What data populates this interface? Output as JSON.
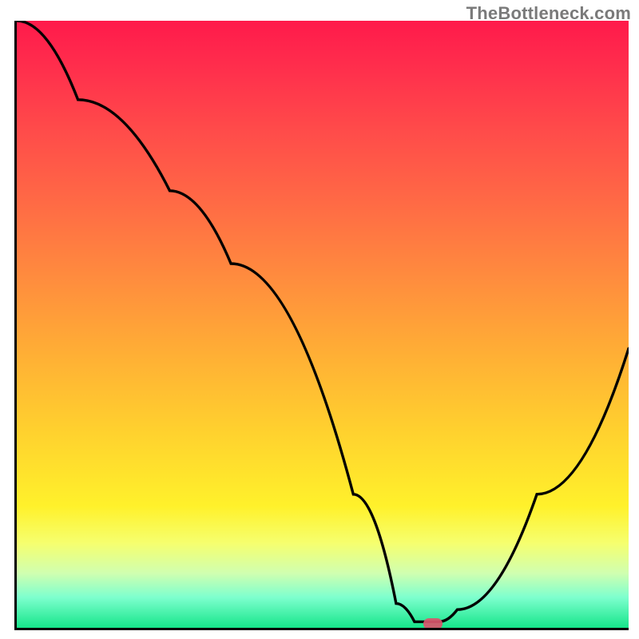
{
  "watermark": "TheBottleneck.com",
  "chart_data": {
    "type": "line",
    "title": "",
    "xlabel": "",
    "ylabel": "",
    "xlim": [
      0,
      100
    ],
    "ylim": [
      0,
      100
    ],
    "series": [
      {
        "name": "curve",
        "x": [
          0,
          10,
          25,
          35,
          55,
          62,
          65,
          69,
          72,
          85,
          100
        ],
        "y": [
          100,
          87,
          72,
          60,
          22,
          4,
          1,
          1,
          3,
          22,
          46
        ]
      }
    ],
    "marker": {
      "x": 68,
      "y": 0.6
    },
    "colors": {
      "gradient_top": "#ff1a4b",
      "gradient_mid": "#ffd22e",
      "gradient_bottom": "#16e58a",
      "axis": "#000000",
      "curve": "#000000",
      "marker": "#d9566d"
    }
  }
}
